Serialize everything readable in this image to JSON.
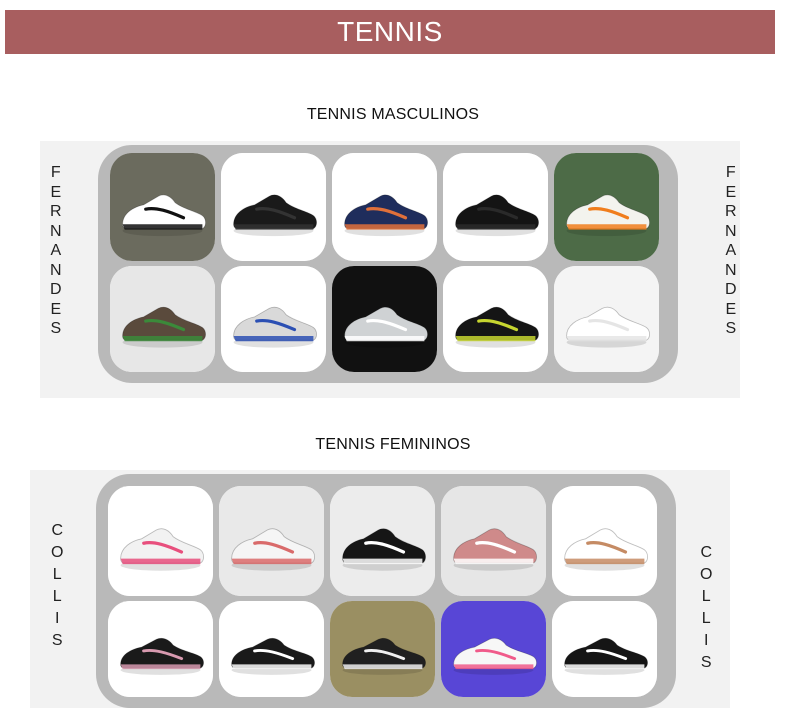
{
  "header": {
    "title": "TENNIS"
  },
  "masculinos": {
    "title": "TENNIS MASCULINOS",
    "brand_letters": [
      "F",
      "E",
      "R",
      "N",
      "A",
      "N",
      "D",
      "E",
      "S"
    ],
    "products": [
      {
        "name": "shoe-on-foot-black-white",
        "icon": "sneaker-icon",
        "bg": "#6b6b5e",
        "shoe": "#ffffff",
        "accent": "#111111"
      },
      {
        "name": "black-air-max",
        "icon": "sneaker-icon",
        "bg": "#ffffff",
        "shoe": "#1a1a1a",
        "accent": "#333333"
      },
      {
        "name": "navy-orange-pair",
        "icon": "sneaker-icon",
        "bg": "#ffffff",
        "shoe": "#1f2d5c",
        "accent": "#e0703a"
      },
      {
        "name": "black-running",
        "icon": "sneaker-icon",
        "bg": "#ffffff",
        "shoe": "#141414",
        "accent": "#2a2a2a"
      },
      {
        "name": "white-orange-in-hand",
        "icon": "sneaker-icon",
        "bg": "#4d6b47",
        "shoe": "#f3f3ee",
        "accent": "#f07d1c"
      },
      {
        "name": "brown-green-runner",
        "icon": "sneaker-icon",
        "bg": "#e7e7e7",
        "shoe": "#5a4a3c",
        "accent": "#3b8a3a"
      },
      {
        "name": "white-blue-air-max",
        "icon": "sneaker-icon",
        "bg": "#ffffff",
        "shoe": "#d9d9d9",
        "accent": "#2b4fb3"
      },
      {
        "name": "silver-air-max-97",
        "icon": "sneaker-icon",
        "bg": "#111111",
        "shoe": "#cfd2d4",
        "accent": "#ffffff"
      },
      {
        "name": "black-tn-pair",
        "icon": "sneaker-icon",
        "bg": "#ffffff",
        "shoe": "#151515",
        "accent": "#c7d630"
      },
      {
        "name": "white-air-force",
        "icon": "sneaker-icon",
        "bg": "#f4f4f4",
        "shoe": "#ffffff",
        "accent": "#e5e5e5"
      }
    ]
  },
  "femininos": {
    "title": "TENNIS FEMININOS",
    "brand_letters": [
      "C",
      "O",
      "L",
      "L",
      "I",
      "S"
    ],
    "products": [
      {
        "name": "white-pink-runner",
        "icon": "sneaker-icon",
        "bg": "#ffffff",
        "shoe": "#f2f2f2",
        "accent": "#e84f7d"
      },
      {
        "name": "white-high-top",
        "icon": "sneaker-icon",
        "bg": "#e9e9e9",
        "shoe": "#f5f5f5",
        "accent": "#d96a6a"
      },
      {
        "name": "black-vans-pair",
        "icon": "sneaker-icon",
        "bg": "#ececec",
        "shoe": "#161616",
        "accent": "#ffffff"
      },
      {
        "name": "pink-vans-pair",
        "icon": "sneaker-icon",
        "bg": "#e6e6e6",
        "shoe": "#cf8a8a",
        "accent": "#ffffff"
      },
      {
        "name": "white-on-legs",
        "icon": "sneaker-icon",
        "bg": "#ffffff",
        "shoe": "#ffffff",
        "accent": "#c58b64"
      },
      {
        "name": "black-pink-runner",
        "icon": "sneaker-icon",
        "bg": "#ffffff",
        "shoe": "#1a1a1a",
        "accent": "#d89ab0"
      },
      {
        "name": "black-converse-low",
        "icon": "sneaker-icon",
        "bg": "#ffffff",
        "shoe": "#1a1a1a",
        "accent": "#ffffff"
      },
      {
        "name": "checkered-vans-worn",
        "icon": "sneaker-icon",
        "bg": "#9a8f62",
        "shoe": "#202020",
        "accent": "#f0f0f0"
      },
      {
        "name": "blue-pink-trainer",
        "icon": "sneaker-icon",
        "bg": "#5846d6",
        "shoe": "#f7f7f7",
        "accent": "#f05a8a"
      },
      {
        "name": "black-pair-runner",
        "icon": "sneaker-icon",
        "bg": "#ffffff",
        "shoe": "#151515",
        "accent": "#ffffff"
      }
    ]
  }
}
